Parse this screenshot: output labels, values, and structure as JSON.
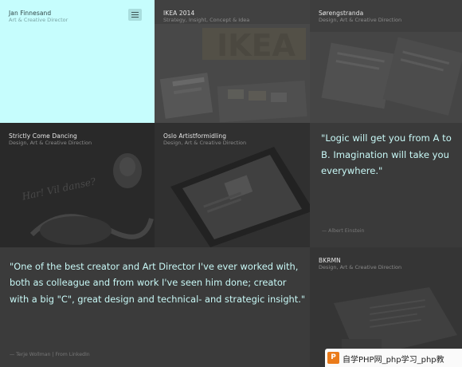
{
  "intro": {
    "name": "Jan Finnesand",
    "role": "Art & Creative Director",
    "menu_icon": "hamburger-menu-icon"
  },
  "tiles": [
    {
      "title": "IKEA 2014",
      "subtitle": "Strategy, Insight, Concept & Idea"
    },
    {
      "title": "Sørengstranda",
      "subtitle": "Design, Art & Creative Direction"
    },
    {
      "title": "Strictly Come Dancing",
      "subtitle": "Design, Art & Creative Direction"
    },
    {
      "title": "Oslo Artistformidling",
      "subtitle": "Design, Art & Creative Direction"
    },
    {
      "title": "BKRMN",
      "subtitle": "Design, Art & Creative Direction"
    }
  ],
  "quotes": [
    {
      "text": "\"Logic will get you from A to B. Imagination will take you everywhere.\"",
      "author": "— Albert Einstein"
    },
    {
      "text": "\"One of the best creator and Art Director I've ever worked with, both as colleague and from work I've seen him done; creator with a big \"C\", great design and technical- and strategic insight.\"",
      "author": "— Terje Wollman | From LinkedIn"
    }
  ],
  "decor_text": {
    "ikea_banner": "IKEA",
    "dance_script": "Har! Vil danse?"
  },
  "watermark": {
    "logo": "P",
    "text": "自学PHP网_php学习_php教"
  },
  "colors": {
    "intro_bg": "#c6fdfd",
    "quote_text": "#c8f8f6",
    "page_bg": "#3a3a3a"
  }
}
